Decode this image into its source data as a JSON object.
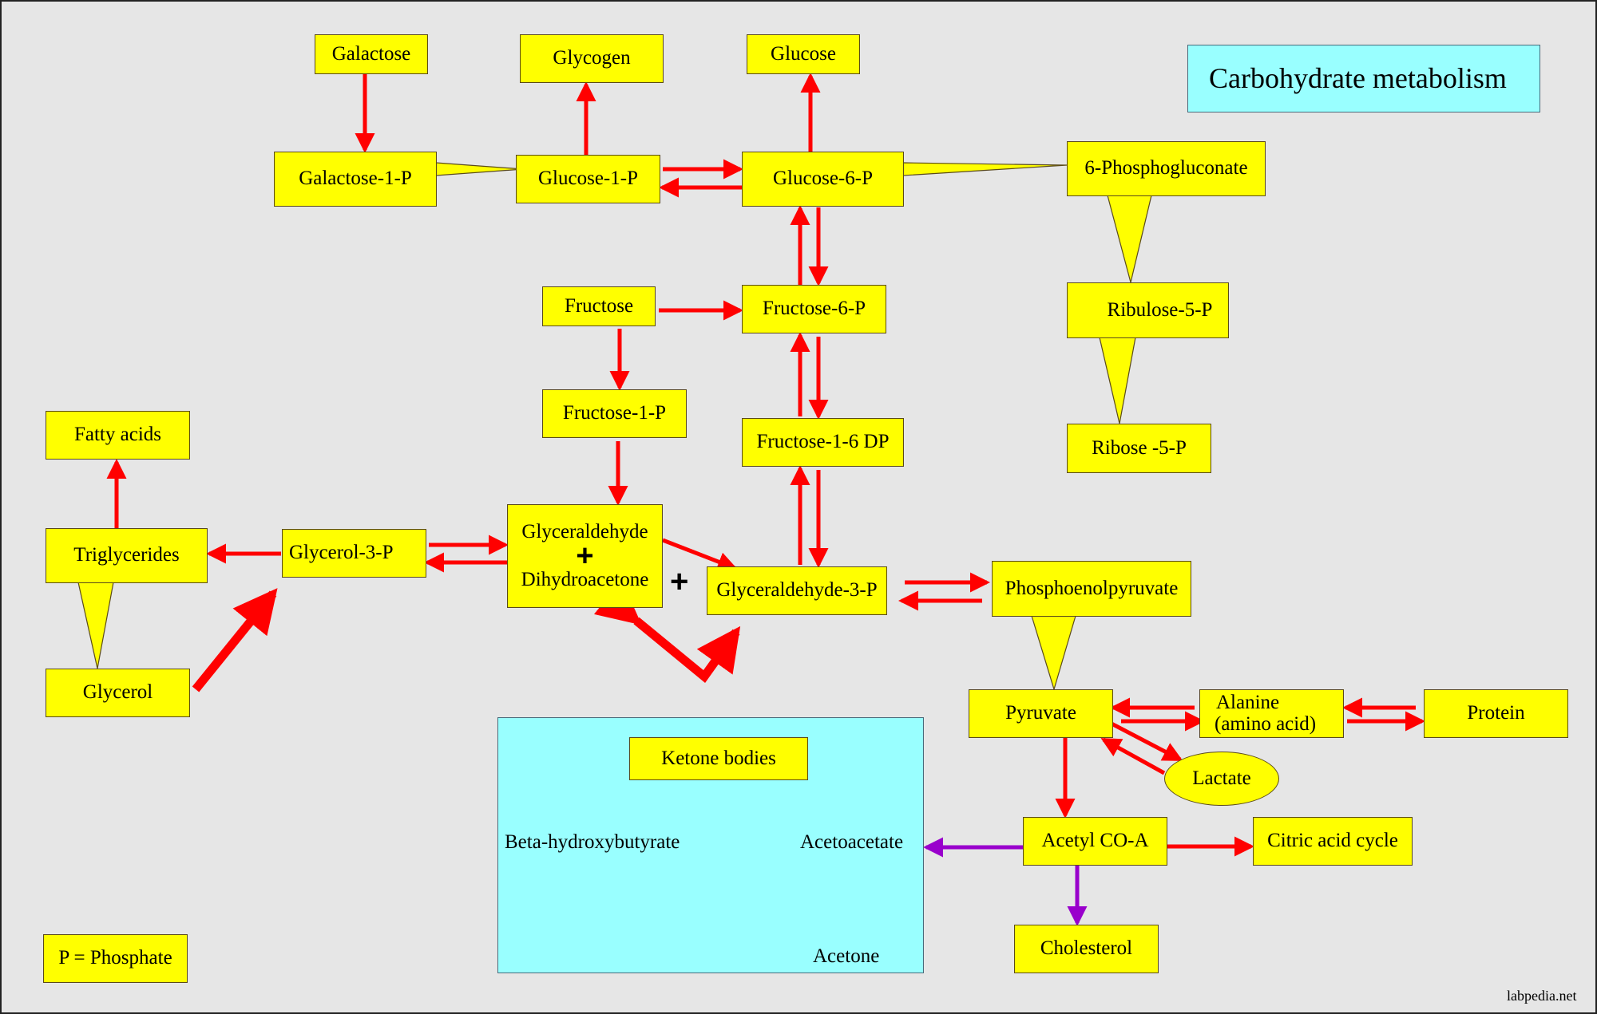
{
  "title": "Carbohydrate metabolism",
  "legend": "P = Phosphate",
  "watermark": "labpedia.net",
  "colors": {
    "node_fill": "#ffff00",
    "panel_fill": "#99ffff",
    "main_arrow": "#ff0000",
    "ketone_arrow": "#339966",
    "acetone_arrow": "#009933",
    "acetyl_branch_arrow": "#9900cc",
    "background": "#e6e6e6"
  },
  "nodes": {
    "galactose": "Galactose",
    "glycogen": "Glycogen",
    "glucose": "Glucose",
    "galactose_1_p": "Galactose-1-P",
    "glucose_1_p": "Glucose-1-P",
    "glucose_6_p": "Glucose-6-P",
    "phosphogluconate": "6-Phosphogluconate",
    "ribulose_5_p": "Ribulose-5-P",
    "ribose_5_p": "Ribose -5-P",
    "fructose": "Fructose",
    "fructose_6_p": "Fructose-6-P",
    "fructose_1_p": "Fructose-1-P",
    "fructose_1_6_dp": "Fructose-1-6 DP",
    "fatty_acids": "Fatty acids",
    "triglycerides": "Triglycerides",
    "glycerol_3_p": "Glycerol-3-P",
    "glycerol": "Glycerol",
    "glyceraldehyde": "Glyceraldehyde",
    "dihydroacetone": "Dihydroacetone",
    "glyceraldehyde_3_p": "Glyceraldehyde-3-P",
    "phosphoenolpyruvate": "Phosphoenolpyruvate",
    "pyruvate": "Pyruvate",
    "alanine_line1": "Alanine",
    "alanine_line2": "(amino acid)",
    "protein": "Protein",
    "lactate": "Lactate",
    "acetyl_coa": "Acetyl CO-A",
    "citric_acid_cycle": "Citric acid cycle",
    "cholesterol": "Cholesterol",
    "ketone_bodies": "Ketone bodies",
    "beta_hydroxybutyrate": "Beta-hydroxybutyrate",
    "acetoacetate": "Acetoacetate",
    "acetone": "Acetone"
  },
  "symbols": {
    "plus": "+"
  },
  "edges": [
    {
      "from": "Galactose",
      "to": "Galactose-1-P",
      "type": "arrow"
    },
    {
      "from": "Galactose-1-P",
      "to": "Glucose-1-P",
      "type": "callout"
    },
    {
      "from": "Glucose-1-P",
      "to": "Glycogen",
      "type": "arrow"
    },
    {
      "from": "Glucose-1-P",
      "to": "Glucose-6-P",
      "type": "reversible"
    },
    {
      "from": "Glucose-6-P",
      "to": "Glucose",
      "type": "arrow"
    },
    {
      "from": "Glucose-6-P",
      "to": "6-Phosphogluconate",
      "type": "callout"
    },
    {
      "from": "6-Phosphogluconate",
      "to": "Ribulose-5-P",
      "type": "callout"
    },
    {
      "from": "Ribulose-5-P",
      "to": "Ribose -5-P",
      "type": "callout"
    },
    {
      "from": "Glucose-6-P",
      "to": "Fructose-6-P",
      "type": "reversible"
    },
    {
      "from": "Fructose",
      "to": "Fructose-6-P",
      "type": "arrow"
    },
    {
      "from": "Fructose",
      "to": "Fructose-1-P",
      "type": "arrow"
    },
    {
      "from": "Fructose-6-P",
      "to": "Fructose-1-6 DP",
      "type": "reversible"
    },
    {
      "from": "Fructose-1-6 DP",
      "to": "Glyceraldehyde-3-P",
      "type": "reversible"
    },
    {
      "from": "Fructose-1-P",
      "to": "Glyceraldehyde + Dihydroacetone",
      "type": "arrow"
    },
    {
      "from": "Glyceraldehyde + Dihydroacetone",
      "to": "Glyceraldehyde-3-P",
      "type": "arrow"
    },
    {
      "from": "Dihydroacetone",
      "to": "Glyceraldehyde-3-P",
      "type": "reversible-bold"
    },
    {
      "from": "Glycerol-3-P",
      "to": "Glyceraldehyde + Dihydroacetone",
      "type": "reversible"
    },
    {
      "from": "Glycerol-3-P",
      "to": "Triglycerides",
      "type": "arrow"
    },
    {
      "from": "Triglycerides",
      "to": "Fatty acids",
      "type": "arrow"
    },
    {
      "from": "Triglycerides",
      "to": "Glycerol",
      "type": "callout"
    },
    {
      "from": "Glycerol",
      "to": "Glycerol-3-P",
      "type": "arrow-bold"
    },
    {
      "from": "Glyceraldehyde-3-P",
      "to": "Phosphoenolpyruvate",
      "type": "reversible"
    },
    {
      "from": "Phosphoenolpyruvate",
      "to": "Pyruvate",
      "type": "callout"
    },
    {
      "from": "Pyruvate",
      "to": "Alanine",
      "type": "reversible"
    },
    {
      "from": "Alanine",
      "to": "Protein",
      "type": "reversible"
    },
    {
      "from": "Pyruvate",
      "to": "Lactate",
      "type": "reversible"
    },
    {
      "from": "Pyruvate",
      "to": "Acetyl CO-A",
      "type": "arrow"
    },
    {
      "from": "Acetyl CO-A",
      "to": "Citric acid cycle",
      "type": "arrow"
    },
    {
      "from": "Acetyl CO-A",
      "to": "Acetoacetate",
      "type": "arrow"
    },
    {
      "from": "Acetyl CO-A",
      "to": "Cholesterol",
      "type": "arrow"
    },
    {
      "from": "Beta-hydroxybutyrate",
      "to": "Acetoacetate",
      "type": "reversible"
    },
    {
      "from": "Acetoacetate",
      "to": "Acetone",
      "type": "arrow"
    }
  ]
}
